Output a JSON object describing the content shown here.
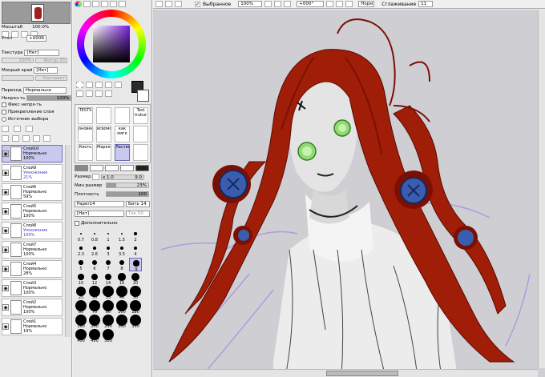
{
  "nav": {
    "zoom_label": "Масштаб",
    "zoom_value": "100.0%",
    "angle_label": "Угол",
    "angle_value": "+000R"
  },
  "paper": {
    "texture_label": "Текстура",
    "texture_value": "[Нет]",
    "texture_scale": "100%",
    "texture_strength": "Фигур 20",
    "edge_label": "Мокрый край",
    "edge_value": "[Нет]",
    "edge_amount": "Контраст"
  },
  "layer_props": {
    "blend_label": "Переход",
    "blend_value": "Нормально",
    "opacity_label": "Непроз-ть",
    "opacity_value": "100%",
    "opacity_fraction": 1.0,
    "opt_fix": "Фикс непрз-ть",
    "opt_clip": "Прикрепление слоя",
    "opt_source": "Источник выбора"
  },
  "layers": [
    {
      "name": "Слой10",
      "mode": "Нормально",
      "opacity": "100%",
      "selected": true,
      "blue": false
    },
    {
      "name": "Слой9",
      "mode": "Умножение",
      "opacity": "21%",
      "selected": false,
      "blue": true
    },
    {
      "name": "Слой6",
      "mode": "Нормально",
      "opacity": "59%",
      "selected": false,
      "blue": false
    },
    {
      "name": "Слой5",
      "mode": "Нормально",
      "opacity": "100%",
      "selected": false,
      "blue": false
    },
    {
      "name": "Слой8",
      "mode": "Умножение",
      "opacity": "100%",
      "selected": false,
      "blue": true
    },
    {
      "name": "Слой7",
      "mode": "Нормально",
      "opacity": "100%",
      "selected": false,
      "blue": false
    },
    {
      "name": "Слой4",
      "mode": "Нормально",
      "opacity": "28%",
      "selected": false,
      "blue": false
    },
    {
      "name": "Слой3",
      "mode": "Нормально",
      "opacity": "100%",
      "selected": false,
      "blue": false
    },
    {
      "name": "Слой2",
      "mode": "Нормально",
      "opacity": "100%",
      "selected": false,
      "blue": false
    },
    {
      "name": "Слой1",
      "mode": "Нормально",
      "opacity": "19%",
      "selected": false,
      "blue": false
    }
  ],
  "brushes": {
    "row1": [
      "TESTS",
      "",
      "",
      "Test trukur"
    ],
    "row2": [
      "оновен",
      "всвомот",
      "как мягк",
      ""
    ],
    "row3": [
      "Кисть",
      "Маркер",
      "Ластик",
      ""
    ]
  },
  "brush_settings": {
    "size_label": "Размер",
    "size_mult": "x 1.0",
    "size_value": "9.0",
    "minsize_label": "Мин размер",
    "minsize_value": "23%",
    "minsize_fraction": 0.23,
    "density_label": "Плотность",
    "density_value": "100",
    "density_fraction": 1.0,
    "texture_value": "Paper14",
    "texture_strength": "Бить 14",
    "shape_value": "[Нет]",
    "shape_strength": "Тек 50",
    "advanced_label": "Дополнительно"
  },
  "size_presets": [
    "0.7",
    "0.8",
    "1",
    "1.5",
    "2",
    "2.3",
    "2.6",
    "3",
    "3.5",
    "4",
    "5",
    "6",
    "7",
    "8",
    "9",
    "10",
    "12",
    "14",
    "16",
    "20",
    "25",
    "30",
    "35",
    "40",
    "50",
    "60",
    "70",
    "80",
    "100",
    "120",
    "160",
    "200",
    "250",
    "300",
    "350",
    "400",
    "450",
    "500"
  ],
  "toolbar": {
    "selected_label": "Выбранное",
    "zoom_value": "100%",
    "angle_value": "+000°",
    "mode_value": "Норм",
    "smoothing_label": "Сглаживание",
    "smoothing_value": "11"
  },
  "colors": {
    "accent": "#c9c9f0",
    "hair": "#a01e08",
    "button": "#3a5db0",
    "eye": "#8fdc70"
  }
}
